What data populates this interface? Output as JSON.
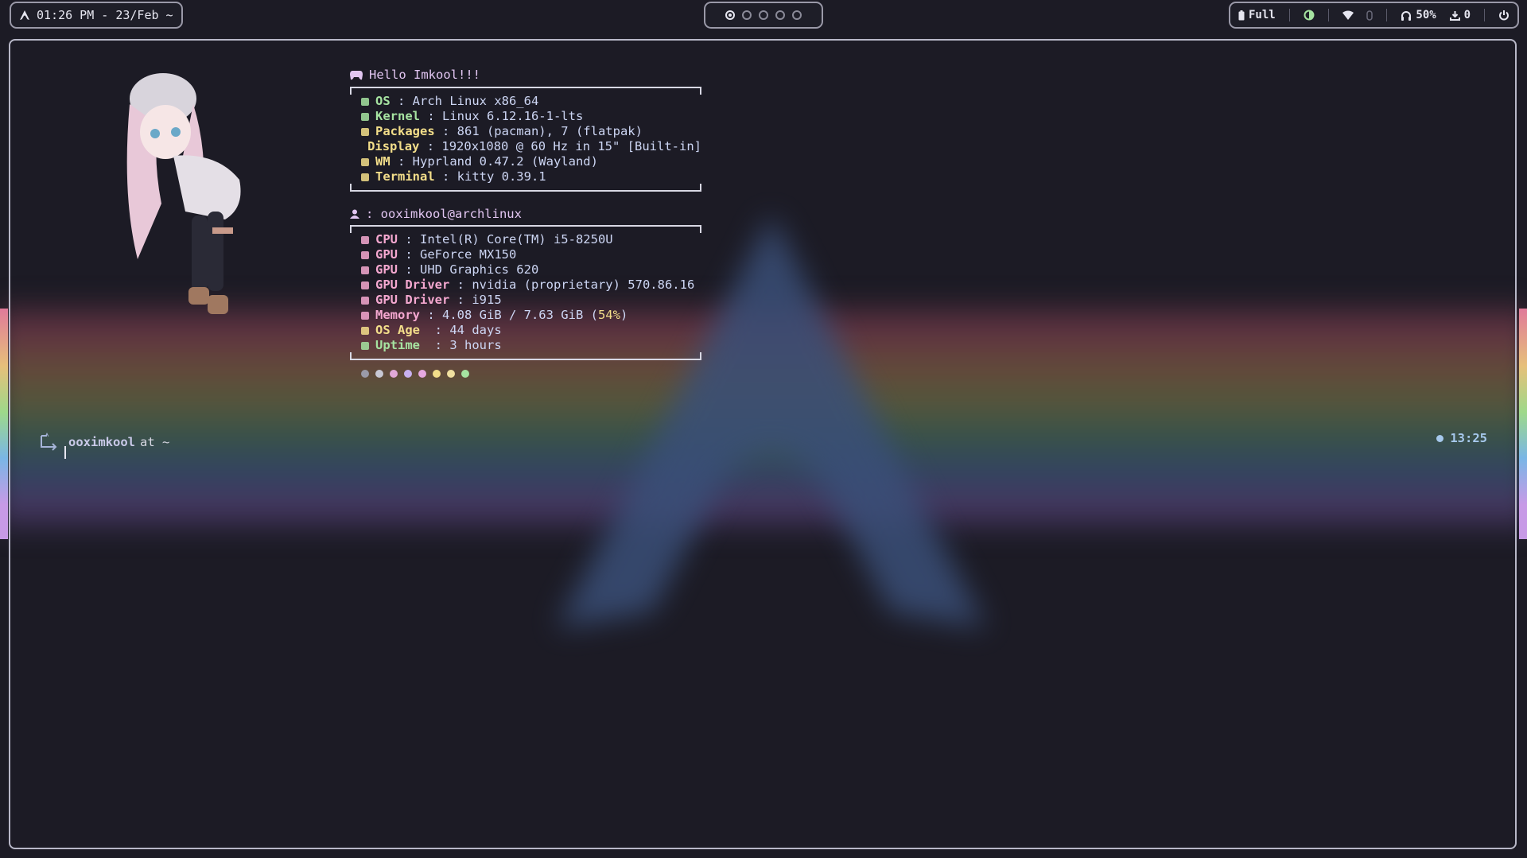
{
  "topbar": {
    "datetime": "01:26 PM - 23/Feb ~",
    "workspaces": [
      {
        "name": "workspace-1",
        "active": true
      },
      {
        "name": "workspace-2",
        "active": false
      },
      {
        "name": "workspace-3",
        "active": false
      },
      {
        "name": "workspace-4",
        "active": false
      },
      {
        "name": "workspace-5",
        "active": false
      }
    ],
    "battery_label": "Full",
    "volume_label": "50%",
    "updates_label": "0",
    "icons": [
      "arch-icon",
      "battery-icon",
      "brightness-icon",
      "wifi-icon",
      "bluetooth-icon",
      "headphones-icon",
      "download-icon",
      "power-icon"
    ]
  },
  "fetch": {
    "greeting": "Hello Imkool!!!",
    "system": [
      {
        "key": "OS",
        "value": " : Arch Linux x86_64",
        "icon": "arch-icon",
        "color": "#a6e3a1"
      },
      {
        "key": "Kernel",
        "value": " : Linux 6.12.16-1-lts",
        "icon": "gear-icon",
        "color": "#a6e3a1"
      },
      {
        "key": "Packages",
        "value": " : 861 (pacman), 7 (flatpak)",
        "icon": "package-icon",
        "color": "#f3de8a"
      },
      {
        "key": "Display",
        "value": " : 1920x1080 @ 60 Hz in 15\" [Built-in]",
        "icon": "monitor-icon",
        "color": "#f3de8a"
      },
      {
        "key": "WM",
        "value": " : Hyprland 0.47.2 (Wayland)",
        "icon": "window-icon",
        "color": "#f3de8a"
      },
      {
        "key": "Terminal",
        "value": " : kitty 0.39.1",
        "icon": "terminal-icon",
        "color": "#f3de8a"
      }
    ],
    "user_host": " : ooximkool@archlinux",
    "hardware": [
      {
        "key": "CPU",
        "value": " : Intel(R) Core(TM) i5-8250U",
        "icon": "cpu-icon",
        "color": "#f5a8d0"
      },
      {
        "key": "GPU",
        "value": " : GeForce MX150",
        "icon": "gpu-icon",
        "color": "#f5a8d0"
      },
      {
        "key": "GPU",
        "value": " : UHD Graphics 620",
        "icon": "gpu-icon",
        "color": "#f5a8d0"
      },
      {
        "key": "GPU Driver",
        "value": " : nvidia (proprietary) 570.86.16",
        "icon": "driver-icon",
        "color": "#f5a8d0"
      },
      {
        "key": "GPU Driver",
        "value": " : i915",
        "icon": "driver-icon",
        "color": "#f5a8d0"
      },
      {
        "key": "Memory",
        "value": " : 4.08 GiB / 7.63 GiB (",
        "extra": "54%",
        "tail": ")",
        "icon": "memory-icon",
        "color": "#f5a8d0"
      },
      {
        "key": "OS Age",
        "value": "  : 44 days",
        "icon": "hourglass-icon",
        "color": "#f3de8a"
      },
      {
        "key": "Uptime",
        "value": "  : 3 hours",
        "icon": "clock-icon",
        "color": "#a6e3a1"
      }
    ],
    "palette": [
      "#9a9aa8",
      "#c8c8d4",
      "#e2a8d8",
      "#c8b0f0",
      "#e6a8e0",
      "#f3de8a",
      "#f0e0a0",
      "#a6e3a1"
    ]
  },
  "prompt": {
    "user": "ooximkool",
    "at": "at ~",
    "time": "13:25"
  }
}
